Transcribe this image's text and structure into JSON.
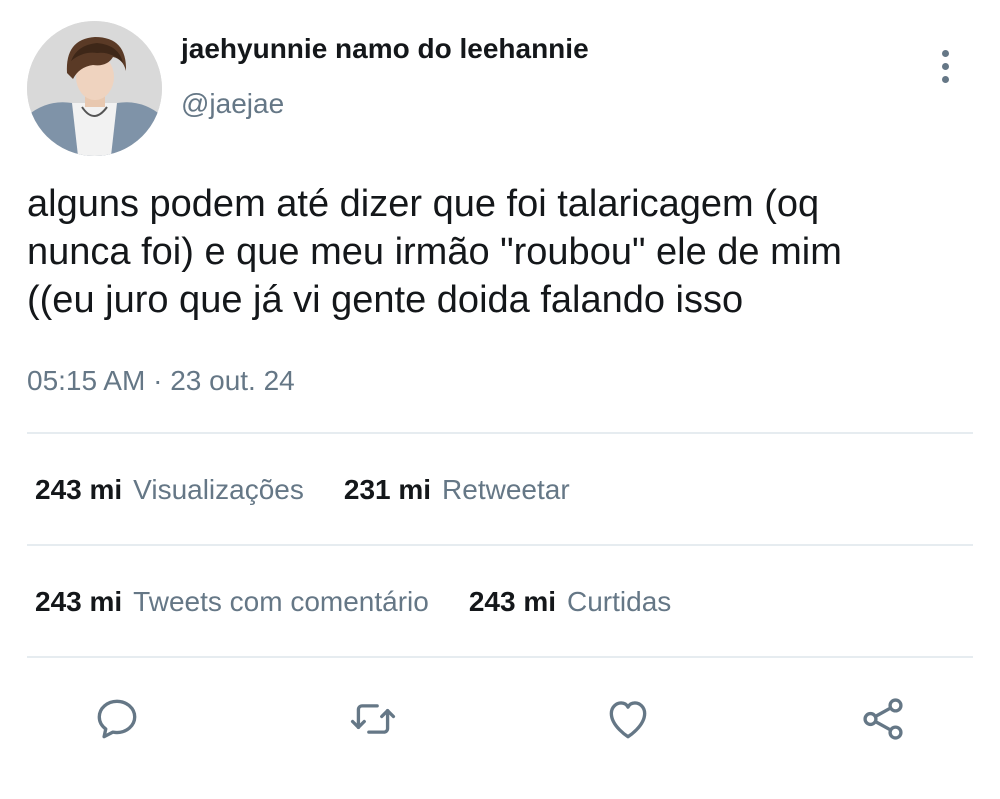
{
  "user": {
    "display_name": "jaehyunnie namo do leehannie",
    "handle": "@jaejae",
    "avatar_icon": "profile-photo"
  },
  "tweet": {
    "lines": [
      "alguns podem até dizer que foi talaricagem (oq",
      "nunca foi) e que meu irmão \"roubou\" ele de mim",
      "((eu juro que já vi gente doida falando isso"
    ],
    "time": "05:15 AM",
    "separator": "·",
    "date": "23 out. 24"
  },
  "stats": {
    "views": {
      "count": "243 mi",
      "label": "Visualizações"
    },
    "retweets": {
      "count": "231 mi",
      "label": "Retweetar"
    },
    "quotes": {
      "count": "243 mi",
      "label": "Tweets com comentário"
    },
    "likes": {
      "count": "243 mi",
      "label": "Curtidas"
    }
  },
  "actions": [
    "reply-icon",
    "retweet-icon",
    "like-icon",
    "share-icon"
  ],
  "colors": {
    "text": "#14171a",
    "secondary": "#657786",
    "divider": "#e6ecf0"
  }
}
